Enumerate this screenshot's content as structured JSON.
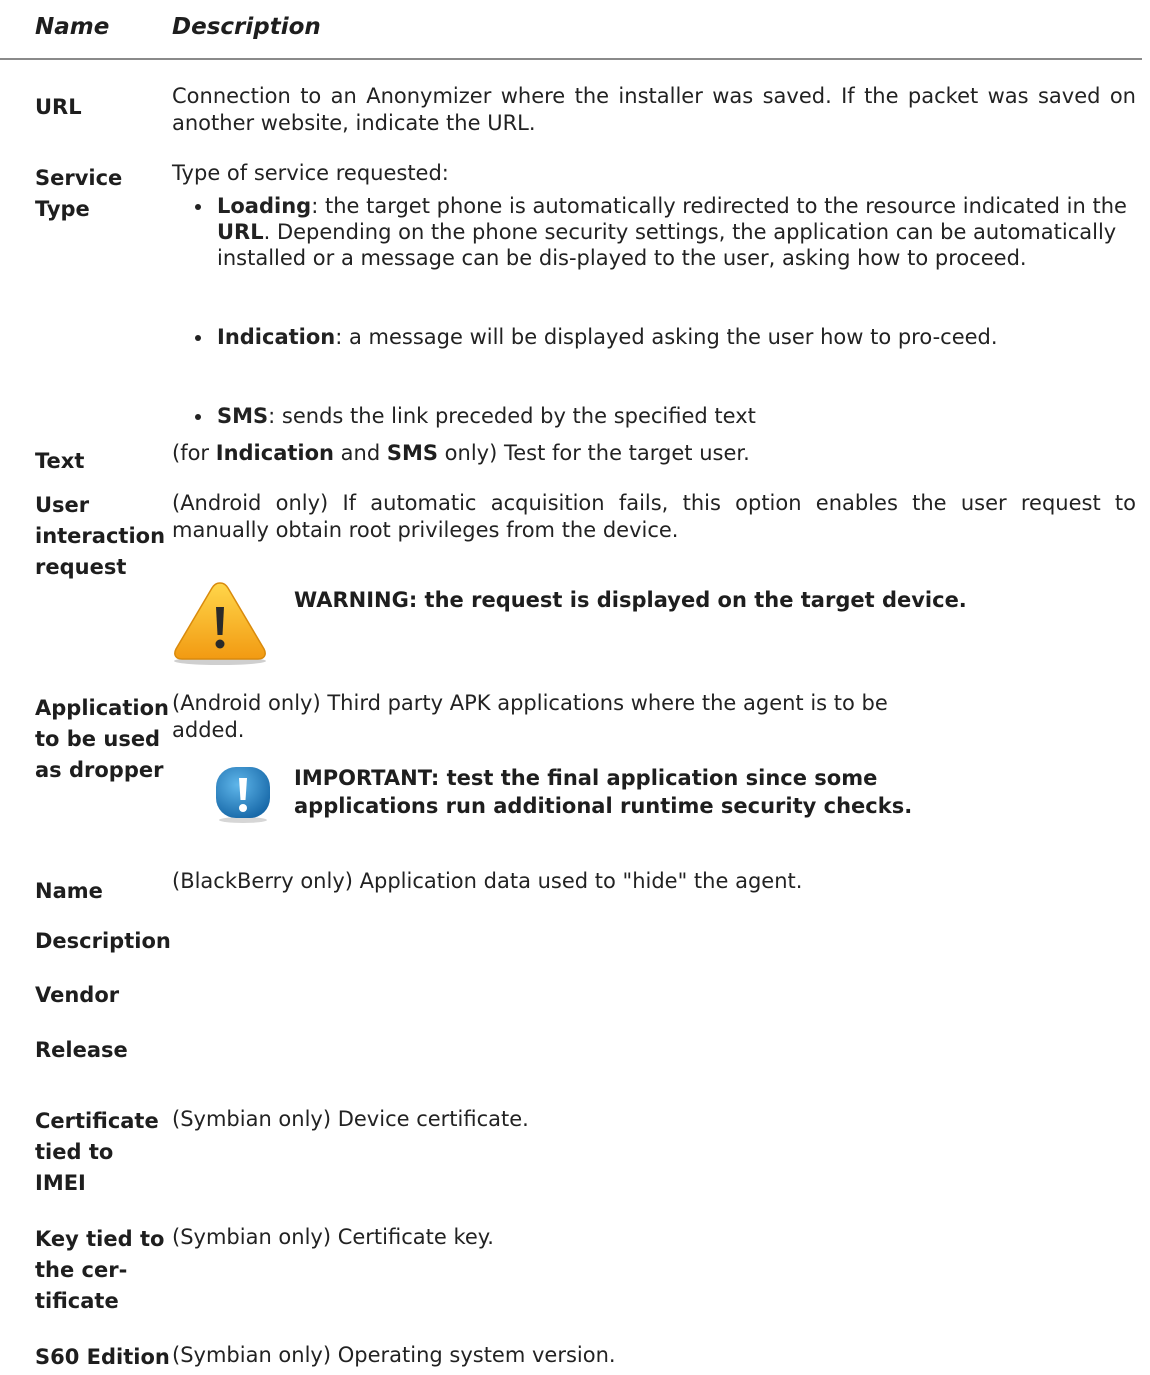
{
  "header": {
    "name": "Name",
    "description": "Description"
  },
  "rows": {
    "url": {
      "label": "URL",
      "text": "Connection to an Anonymizer where the installer was saved. If the packet was saved on another website, indicate the URL."
    },
    "service_type": {
      "label_1": "Service",
      "label_2": "Type",
      "intro": "Type of service requested:",
      "bullets": [
        {
          "term": "Loading",
          "text_1": ": the target phone is automatically redirected to the resource indicated in the ",
          "term_2": "URL",
          "text_2": ". Depending on the phone security settings, the application can be automatically installed or a message can be dis-played to the user, asking how to proceed."
        },
        {
          "term": "Indication",
          "text": ": a message will be displayed asking the user how to pro-ceed."
        },
        {
          "term": "SMS",
          "text": ": sends the link preceded by the specified text"
        }
      ]
    },
    "text": {
      "label": "Text",
      "p1": "(for ",
      "t1": "Indication",
      "p2": " and ",
      "t2": "SMS",
      "p3": " only) Test for the target user."
    },
    "user_interaction": {
      "label_1": "User",
      "label_2": "interaction",
      "label_3": "request",
      "text": "(Android only) If automatic acquisition fails, this option enables the user request to manually obtain root privileges from the device.",
      "warning": "WARNING: the request is displayed on the target device.",
      "warning_icon": "warning-triangle-icon"
    },
    "dropper": {
      "label_1": "Application",
      "label_2": "to be used",
      "label_3": "as dropper",
      "text_1": "(Android only) Third party APK applications where the agent is to be",
      "text_2": "added.",
      "important_1": "IMPORTANT: test the final application since some",
      "important_2": "applications run additional runtime security checks.",
      "important_icon": "important-exclamation-icon"
    },
    "name": {
      "label": "Name",
      "text": "(BlackBerry only) Application data used to \"hide\" the agent."
    },
    "description": {
      "label": "Description"
    },
    "vendor": {
      "label": "Vendor"
    },
    "release": {
      "label": "Release"
    },
    "certificate": {
      "label_1": "Certificate",
      "label_2": "tied to",
      "label_3": "IMEI",
      "text": "(Symbian only) Device certificate."
    },
    "key": {
      "label_1": "Key tied to",
      "label_2": "the cer-",
      "label_3": "tificate",
      "text": "(Symbian only) Certificate key."
    },
    "s60": {
      "label": "S60 Edition",
      "text": "(Symbian only) Operating system version."
    }
  },
  "colors": {
    "warning_yellow": "#f6b51d",
    "info_blue": "#1d86c6",
    "rule": "#8a8a8a"
  }
}
